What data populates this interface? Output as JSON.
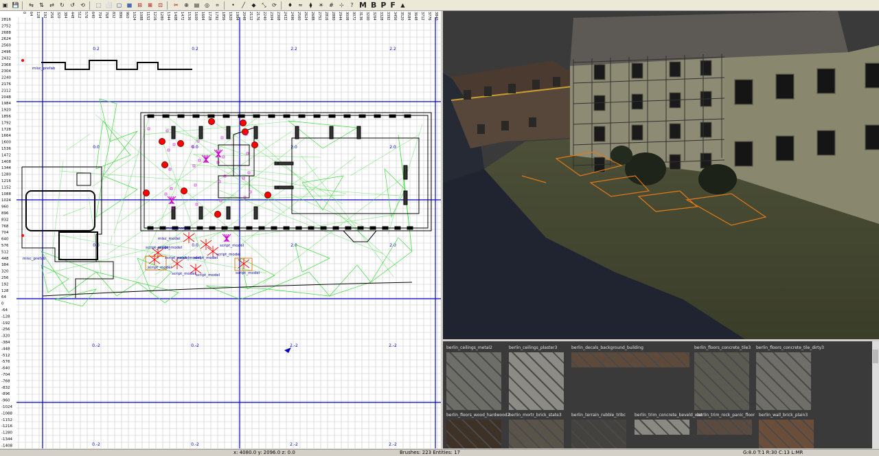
{
  "toolbar": {
    "text_buttons": [
      "M",
      "B",
      "P",
      "F"
    ],
    "icons": [
      "open-icon",
      "save-icon",
      "flip-x-icon",
      "flip-y-icon",
      "flip-z-icon",
      "rotate-x-icon",
      "rotate-y-icon",
      "rotate-z-icon",
      "select-complete-icon",
      "select-touching-icon",
      "select-partial-icon",
      "select-inside-icon",
      "csg-subtract-icon",
      "csg-merge-icon",
      "csg-hollow-icon",
      "clipper-icon",
      "change-view-icon",
      "texture-view-icon",
      "camera-icon",
      "cubic-clip-icon",
      "vertex-icon",
      "edge-icon",
      "face-icon",
      "scale-icon",
      "rotate-icon",
      "entity-icon",
      "patch-icon",
      "filter-icon",
      "lights-icon",
      "grid-icon",
      "snap-icon",
      "help-icon"
    ]
  },
  "grid": {
    "top_ticks": [
      "0",
      "64",
      "128",
      "192",
      "256",
      "320",
      "384",
      "448",
      "512",
      "576",
      "640",
      "704",
      "768",
      "832",
      "896",
      "960",
      "1024",
      "1088",
      "1152",
      "1216",
      "1280",
      "1344",
      "1408",
      "1472",
      "1536",
      "1600",
      "1664",
      "1728",
      "1792",
      "1856",
      "1920",
      "1984",
      "2048",
      "2112",
      "2176",
      "2240",
      "2304",
      "2368",
      "2432",
      "2496",
      "2560",
      "2624",
      "2688",
      "2752",
      "2816",
      "2880",
      "2944",
      "3008",
      "3072",
      "3136",
      "3200",
      "3264",
      "3328",
      "3392",
      "3456",
      "3520",
      "3584",
      "3648",
      "3712",
      "3776",
      "3840",
      "3904",
      "3968",
      "4032"
    ],
    "left_ticks": [
      "2816",
      "2752",
      "2688",
      "2624",
      "2560",
      "2496",
      "2432",
      "2368",
      "2304",
      "2240",
      "2176",
      "2112",
      "2048",
      "1984",
      "1920",
      "1856",
      "1792",
      "1728",
      "1664",
      "1600",
      "1536",
      "1472",
      "1408",
      "1344",
      "1280",
      "1216",
      "1152",
      "1088",
      "1024",
      "960",
      "896",
      "832",
      "768",
      "704",
      "640",
      "576",
      "512",
      "448",
      "384",
      "320",
      "256",
      "192",
      "128",
      "64",
      "0",
      "-64",
      "-128",
      "-192",
      "-256",
      "-320",
      "-384",
      "-448",
      "-512",
      "-576",
      "-640",
      "-704",
      "-768",
      "-832",
      "-896",
      "-960",
      "-1024",
      "-1088",
      "-1152",
      "-1216",
      "-1280",
      "-1344",
      "-1408",
      "-1472",
      "-1536"
    ],
    "region_labels": [
      "0.2",
      "0.2",
      "2.2",
      "2.2",
      "0.0",
      "0.0",
      "2.0",
      "2.0",
      "0.0",
      "0.0",
      "2.0",
      "2.0",
      "0.-2",
      "0.-2",
      "2.-2",
      "2.-2",
      "0.-2",
      "0.-2",
      "2.-2",
      "2.-2"
    ],
    "entity_labels": [
      "misc_prefab",
      "misc_prefab",
      "misc_model",
      "misc_model",
      "script_model",
      "script_model",
      "script_model",
      "script_model",
      "script_model",
      "script_model",
      "script_model",
      "script_model",
      "script_model",
      "script_model",
      "script_model"
    ],
    "colors": {
      "grid_minor": "#c8c8c8",
      "block": "#0000c8",
      "navmesh": "#3cdc3c",
      "brush": "#000000",
      "entity": "#ff0000",
      "prefab": "#d000d0"
    }
  },
  "textures": [
    {
      "name": "berlin_ceilings_metal2",
      "color": "#6e6e68"
    },
    {
      "name": "berlin_ceilings_plaster3",
      "color": "#8c8b85"
    },
    {
      "name": "berlin_decals_background_building",
      "color": "#5e4a3a"
    },
    {
      "name": "berlin_floors_concrete_tile3",
      "color": "#5a5a50"
    },
    {
      "name": "berlin_floors_concrete_tile_dirty3",
      "color": "#706e68"
    },
    {
      "name": "berlin_floors_wood_hardwood2",
      "color": "#3e3126"
    },
    {
      "name": "berlin_mortr_brick_state3",
      "color": "#5a534a"
    },
    {
      "name": "berlin_terrain_rubble_tribc",
      "color": "#44423e"
    },
    {
      "name": "berlin_trim_concrete_beveld_wet",
      "color": "#8a8a82"
    },
    {
      "name": "berlin_trim_rock_panic_floor",
      "color": "#5a4a40"
    },
    {
      "name": "berlin_wall_brick_plain3",
      "color": "#6a4e3a"
    }
  ],
  "status": {
    "coords": "x: 4080.0  y: 2096.0  z: 0.0",
    "counts": "Brushes: 223 Entities: 17",
    "grid": "G:8.0 T:1 R:30 C:13 L:MR"
  }
}
